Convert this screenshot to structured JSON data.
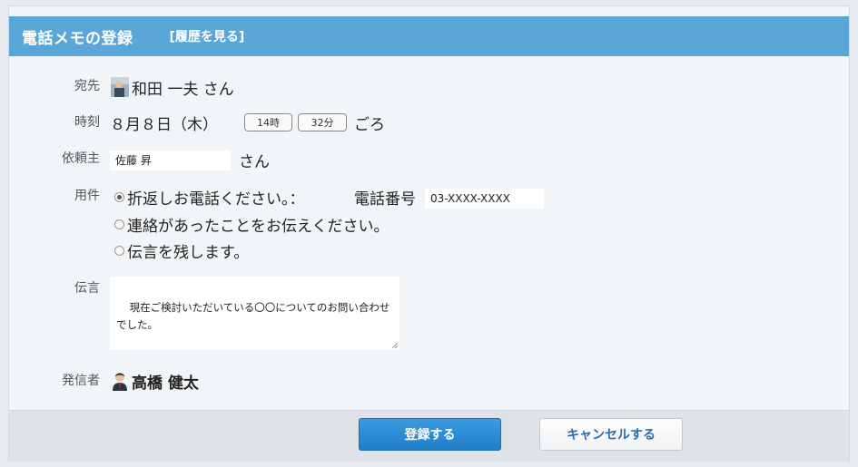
{
  "header": {
    "title": "電話メモの登録",
    "history_link": "[履歴を見る]"
  },
  "form": {
    "recipient": {
      "label": "宛先",
      "name": "和田 一夫 さん"
    },
    "time": {
      "label": "時刻",
      "date": "８月８日（木）",
      "hour": "14時",
      "minute": "32分",
      "suffix": "ごろ"
    },
    "requester": {
      "label": "依頼主",
      "value": "佐藤 昇",
      "suffix": "さん"
    },
    "matter": {
      "label": "用件",
      "options": [
        {
          "text": "折返しお電話ください。：",
          "checked": true
        },
        {
          "text": "連絡があったことをお伝えください。",
          "checked": false
        },
        {
          "text": "伝言を残します。",
          "checked": false
        }
      ],
      "phone_label": "電話番号",
      "phone_value": "03-XXXX-XXXX"
    },
    "message": {
      "label": "伝言",
      "value": "現在ご検討いただいている〇〇についてのお問い合わせでした。"
    },
    "sender": {
      "label": "発信者",
      "name": "高橋 健太"
    }
  },
  "buttons": {
    "submit": "登録する",
    "cancel": "キャンセルする"
  }
}
